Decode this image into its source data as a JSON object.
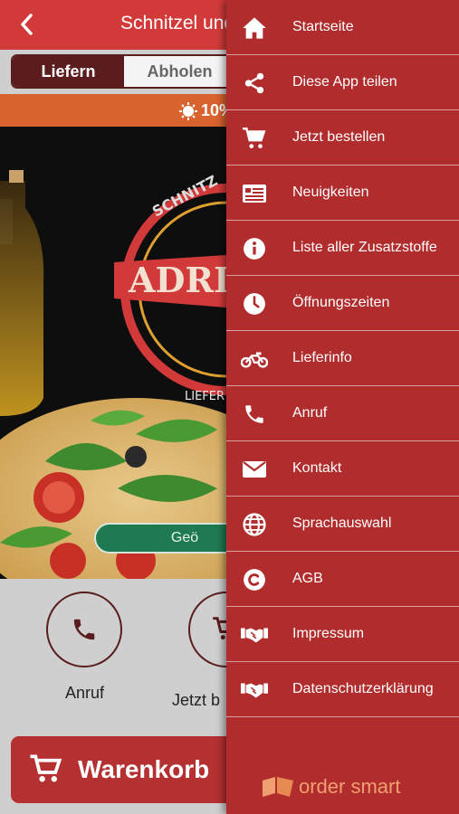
{
  "header": {
    "title": "Schnitzel und"
  },
  "order_mode": {
    "options": [
      "Liefern",
      "Abholen"
    ],
    "selected": "Liefern"
  },
  "promo": {
    "text": "10%"
  },
  "hero": {
    "status_badge": "Geö",
    "logo_text": "ADRI",
    "logo_arc": "SCHNITZ",
    "logo_sub": "LIEFER"
  },
  "actions": [
    {
      "label": "Anruf",
      "icon": "phone-icon"
    },
    {
      "label": "Jetzt b",
      "icon": "cart-icon"
    }
  ],
  "cart": {
    "label": "Warenkorb"
  },
  "drawer": {
    "items": [
      {
        "label": "Startseite",
        "icon": "home-icon"
      },
      {
        "label": "Diese App teilen",
        "icon": "share-icon"
      },
      {
        "label": "Jetzt bestellen",
        "icon": "cart-icon"
      },
      {
        "label": "Neuigkeiten",
        "icon": "news-icon"
      },
      {
        "label": "Liste aller Zusatzstoffe",
        "icon": "info-icon"
      },
      {
        "label": "Öffnungszeiten",
        "icon": "clock-icon"
      },
      {
        "label": "Lieferinfo",
        "icon": "motorcycle-icon"
      },
      {
        "label": "Anruf",
        "icon": "phone-icon"
      },
      {
        "label": "Kontakt",
        "icon": "mail-icon"
      },
      {
        "label": "Sprachauswahl",
        "icon": "globe-icon"
      },
      {
        "label": "AGB",
        "icon": "copyright-icon"
      },
      {
        "label": "Impressum",
        "icon": "handshake-icon"
      },
      {
        "label": "Datenschutzerklärung",
        "icon": "handshake-icon"
      }
    ],
    "brand": "order smart"
  },
  "colors": {
    "header": "#d23a3a",
    "drawer": "#b12c2c",
    "accent_dark": "#5a1c1c",
    "promo": "#d8632e",
    "badge": "#1f7a52"
  }
}
